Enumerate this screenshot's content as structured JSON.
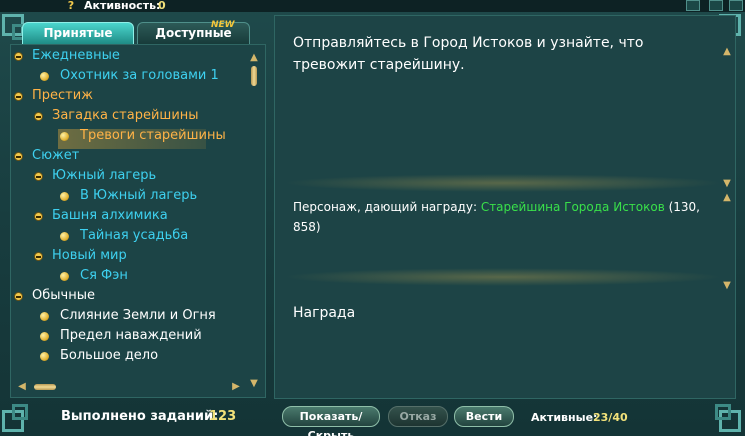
{
  "topbar": {
    "activity_label": "Активность:",
    "activity_value": "0"
  },
  "tabs": {
    "accepted": "Принятые",
    "available": "Доступные",
    "new_badge": "NEW"
  },
  "tree": [
    {
      "label": "Ежедневные",
      "level": 0,
      "kind": "minus",
      "color": "cyan"
    },
    {
      "label": "Охотник за головами 1",
      "level": 1,
      "kind": "dot",
      "color": "cyan"
    },
    {
      "label": "Престиж",
      "level": 0,
      "kind": "minus",
      "color": "orange"
    },
    {
      "label": "Загадка старейшины",
      "level": 1,
      "kind": "minus",
      "color": "orange"
    },
    {
      "label": "Тревоги старейшины",
      "level": 2,
      "kind": "dot",
      "color": "orange",
      "selected": true
    },
    {
      "label": "Сюжет",
      "level": 0,
      "kind": "minus",
      "color": "cyan"
    },
    {
      "label": "Южный лагерь",
      "level": 1,
      "kind": "minus",
      "color": "cyan"
    },
    {
      "label": "В Южный лагерь",
      "level": 2,
      "kind": "dot",
      "color": "cyan"
    },
    {
      "label": "Башня алхимика",
      "level": 1,
      "kind": "minus",
      "color": "cyan"
    },
    {
      "label": "Тайная усадьба",
      "level": 2,
      "kind": "dot",
      "color": "cyan"
    },
    {
      "label": "Новый мир",
      "level": 1,
      "kind": "minus",
      "color": "cyan"
    },
    {
      "label": "Ся Фэн",
      "level": 2,
      "kind": "dot",
      "color": "cyan"
    },
    {
      "label": "Обычные",
      "level": 0,
      "kind": "minus",
      "color": "white"
    },
    {
      "label": "Слияние Земли и Огня",
      "level": 1,
      "kind": "dot",
      "color": "white"
    },
    {
      "label": "Предел наваждений",
      "level": 1,
      "kind": "dot",
      "color": "white"
    },
    {
      "label": "Большое дело",
      "level": 1,
      "kind": "dot",
      "color": "white"
    }
  ],
  "detail": {
    "description": "Отправляйтесь в Город Истоков и узнайте, что тревожит старейшину.",
    "giver_prefix": "Персонаж, дающий награду: ",
    "giver_npc": "Старейшина Города Истоков",
    "giver_coords": " (130, 858)",
    "reward_title": "Награда"
  },
  "footer": {
    "completed_label": "Выполнено заданий:",
    "completed_value": "123",
    "show_hide": "Показать/Скрыть",
    "decline": "Отказ",
    "track": "Вести",
    "active_label": "Активные:",
    "active_value": "23/40"
  },
  "colors": {
    "cyan": "#3ed1f0",
    "orange": "#ffb347",
    "white": "#ffffff",
    "npc_green": "#39e04a",
    "accent_gold": "#f2e27a"
  }
}
